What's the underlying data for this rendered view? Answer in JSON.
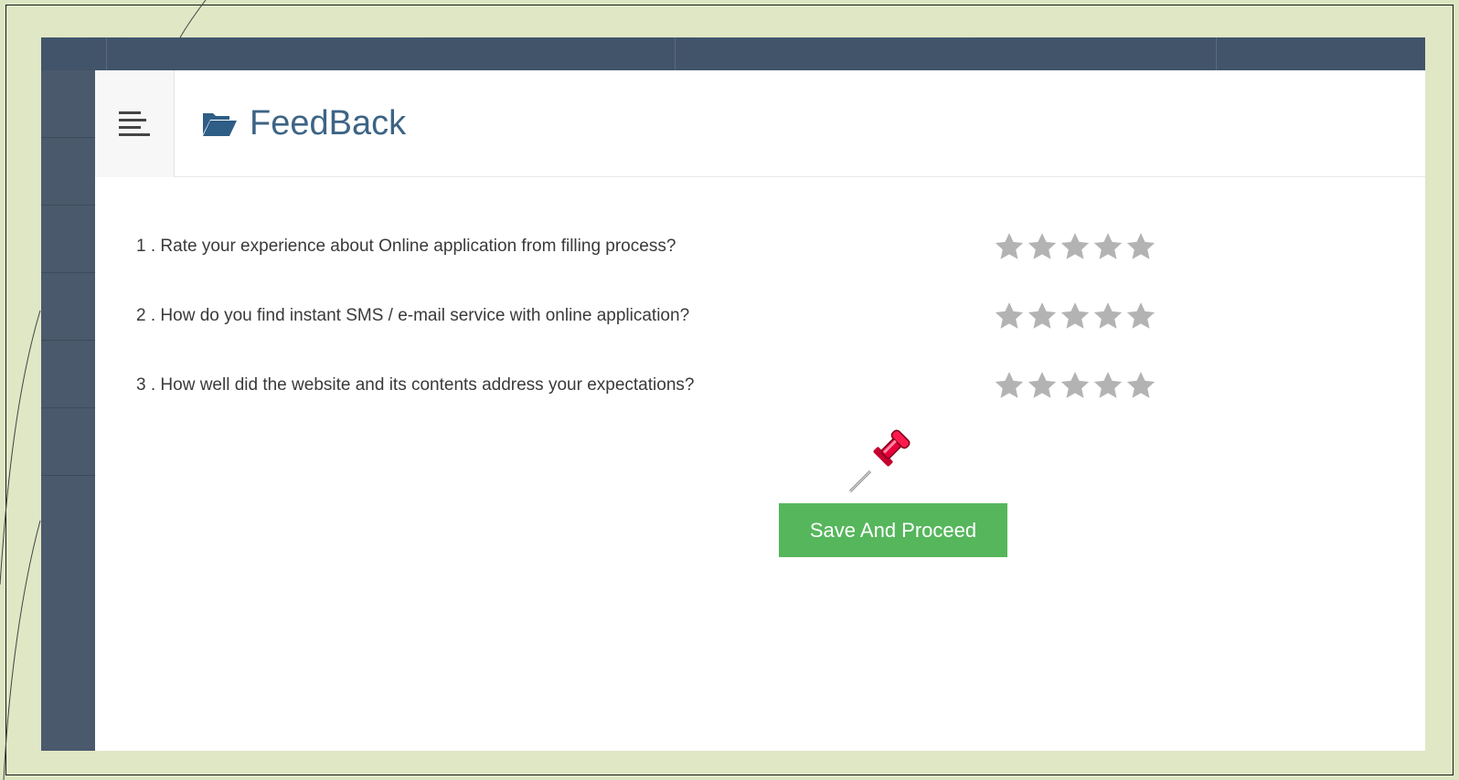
{
  "header": {
    "title": "FeedBack",
    "menu_icon": "hamburger-icon",
    "title_icon": "folder-open-icon"
  },
  "questions": [
    {
      "text": "1 . Rate your experience about Online application from filling process?",
      "stars_max": 5,
      "rating": 0
    },
    {
      "text": "2 . How do you find instant SMS / e-mail service with online application?",
      "stars_max": 5,
      "rating": 0
    },
    {
      "text": "3 . How well did the website and its contents address your expectations?",
      "stars_max": 5,
      "rating": 0
    }
  ],
  "actions": {
    "save_label": "Save And Proceed"
  },
  "colors": {
    "background": "#dde6c3",
    "topnav": "#42546a",
    "sidebar": "#4a5a6c",
    "title": "#3d6485",
    "button": "#56b65c",
    "star_empty": "#b3b3b3",
    "pin": "#e8003a"
  }
}
